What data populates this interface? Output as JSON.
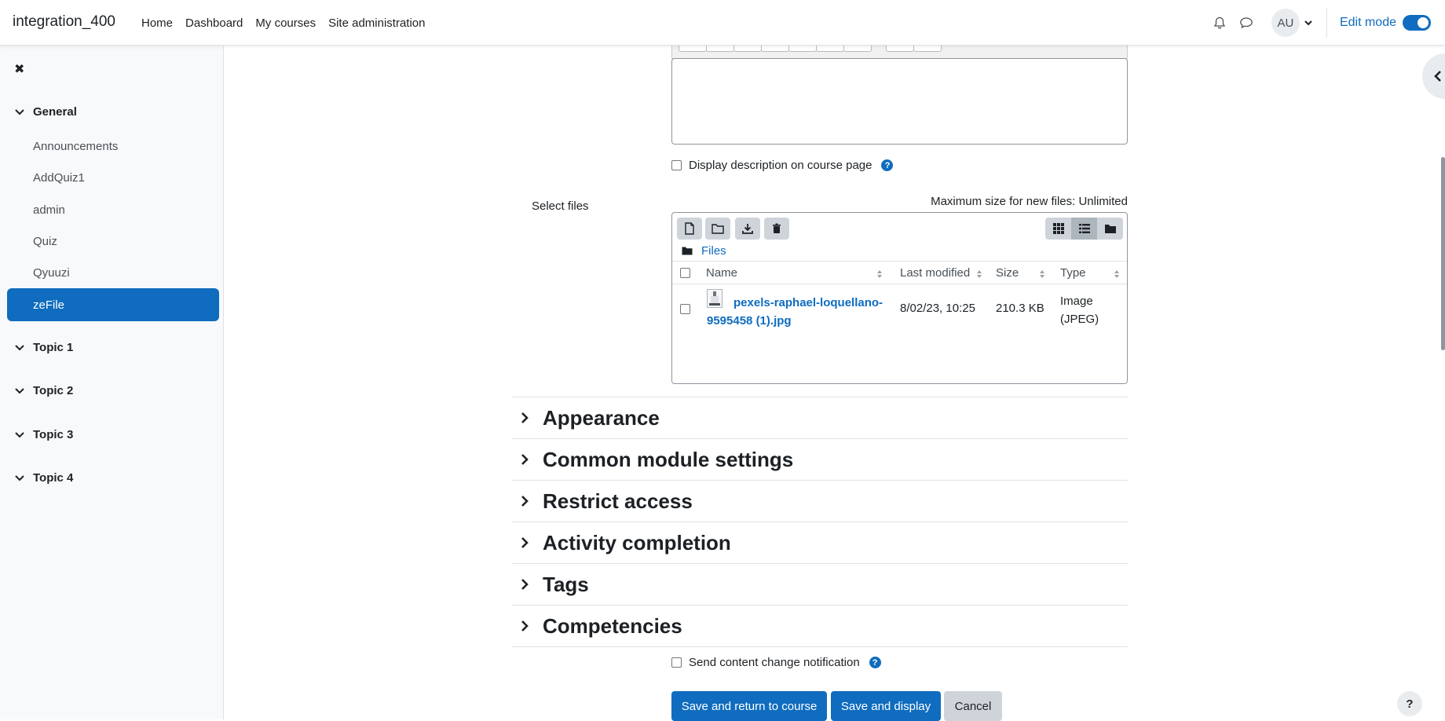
{
  "header": {
    "site_name": "integration_400",
    "nav": [
      "Home",
      "Dashboard",
      "My courses",
      "Site administration"
    ],
    "avatar_initials": "AU",
    "edit_mode_label": "Edit mode",
    "edit_mode_on": true
  },
  "drawer": {
    "sections": [
      {
        "label": "General",
        "expanded": true
      },
      {
        "label": "Topic 1",
        "expanded": true
      },
      {
        "label": "Topic 2",
        "expanded": true
      },
      {
        "label": "Topic 3",
        "expanded": true
      },
      {
        "label": "Topic 4",
        "expanded": true
      }
    ],
    "activities": [
      "Announcements",
      "AddQuiz1",
      "admin",
      "Quiz",
      "Qyuuzi",
      "zeFile"
    ],
    "active_activity": "zeFile"
  },
  "form": {
    "display_description_label": "Display description on course page",
    "select_files_label": "Select files",
    "max_size_text": "Maximum size for new files: Unlimited",
    "filepicker": {
      "breadcrumb": "Files",
      "columns": [
        "Name",
        "Last modified",
        "Size",
        "Type"
      ],
      "files": [
        {
          "name": "pexels-raphael-loquellano-9595458 (1).jpg",
          "modified": "8/02/23, 10:25",
          "size": "210.3 KB",
          "type": "Image (JPEG)"
        }
      ]
    },
    "categories": [
      "Appearance",
      "Common module settings",
      "Restrict access",
      "Activity completion",
      "Tags",
      "Competencies"
    ],
    "notification_label": "Send content change notification",
    "buttons": {
      "save_return": "Save and return to course",
      "save_display": "Save and display",
      "cancel": "Cancel"
    }
  },
  "footer": {
    "help_label": "?"
  },
  "colors": {
    "accent": "#0f6cbf",
    "drawer_bg": "#f8f9fa"
  }
}
